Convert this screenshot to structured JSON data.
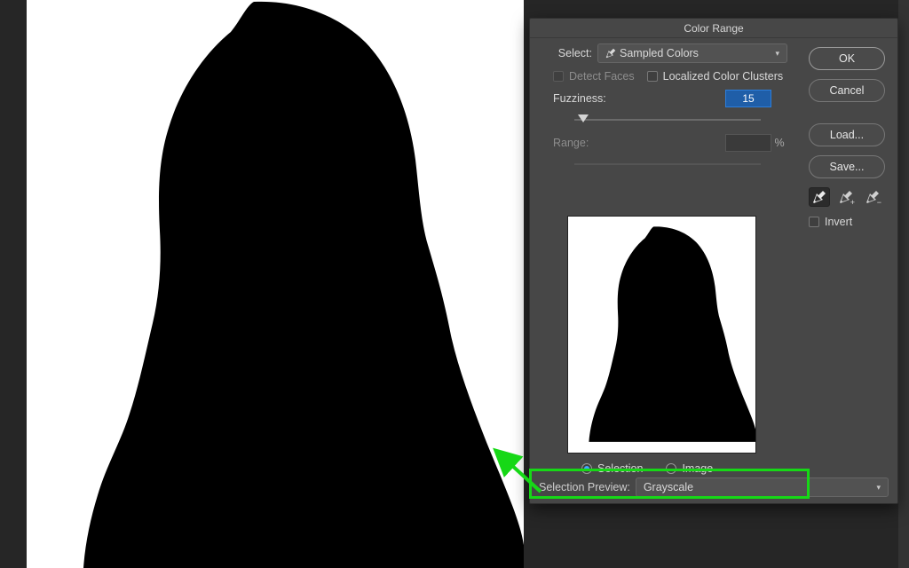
{
  "dialog": {
    "title": "Color Range",
    "select_label": "Select:",
    "select_value": "Sampled Colors",
    "detect_faces": "Detect Faces",
    "localized_clusters": "Localized Color Clusters",
    "fuzziness_label": "Fuzziness:",
    "fuzziness_value": "15",
    "range_label": "Range:",
    "range_value": "",
    "pct": "%",
    "radio_selection": "Selection",
    "radio_image": "Image",
    "selection_preview_label": "Selection Preview:",
    "selection_preview_value": "Grayscale"
  },
  "buttons": {
    "ok": "OK",
    "cancel": "Cancel",
    "load": "Load...",
    "save": "Save...",
    "invert": "Invert"
  },
  "icons": {
    "eyedropper": "eyedropper-icon",
    "eyedropper_plus": "eyedropper-plus-icon",
    "eyedropper_minus": "eyedropper-minus-icon"
  }
}
